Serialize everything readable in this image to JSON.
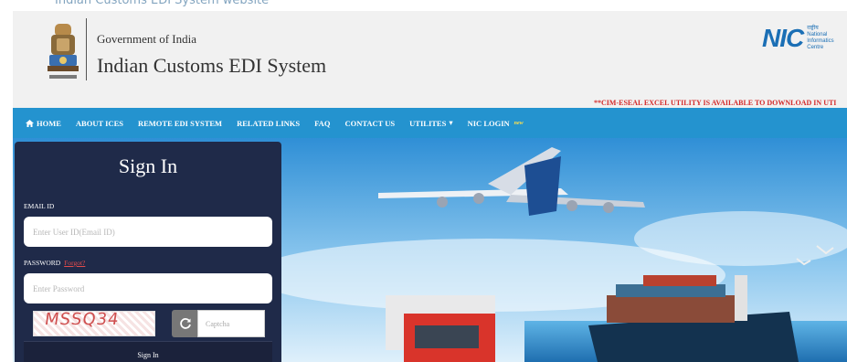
{
  "top_strip": {
    "text": "Indian Customs EDI System website"
  },
  "header": {
    "government": "Government of India",
    "title": "Indian Customs EDI System",
    "nic_brand": "NIC",
    "nic_tagline": [
      "राष्ट्रीय",
      "National",
      "Informatics",
      "Centre"
    ],
    "ticker": "**CIM-ESEAL EXCEL UTILITY IS AVAILABLE TO DOWNLOAD IN UTI"
  },
  "nav": {
    "items": [
      {
        "label": "HOME"
      },
      {
        "label": "ABOUT ICES"
      },
      {
        "label": "REMOTE EDI SYSTEM"
      },
      {
        "label": "RELATED LINKS"
      },
      {
        "label": "FAQ"
      },
      {
        "label": "CONTACT US"
      },
      {
        "label": "UTILITES"
      },
      {
        "label": "NIC LOGIN"
      }
    ],
    "new_badge": "new"
  },
  "signin": {
    "title": "Sign In",
    "email_label": "EMAIL ID",
    "email_placeholder": "Enter User ID(Email ID)",
    "password_label": "PASSWORD",
    "forgot_label": "Forgot?",
    "password_placeholder": "Enter Password",
    "captcha_text": "MSSQ34",
    "captcha_placeholder": "Captcha",
    "button_label": "Sign In"
  },
  "colors": {
    "nav_bg": "#2493cf",
    "panel_bg": "#1f2a49",
    "ticker": "#d42a2a",
    "nic_blue": "#1b6fb5"
  }
}
